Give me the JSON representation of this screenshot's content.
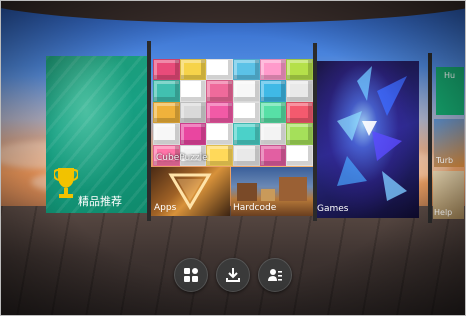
{
  "tiles": {
    "recommended_label": "精品推荐",
    "cubepuzzle_label": "CubePuzzle",
    "apps_label": "Apps",
    "hardcode_label": "Hardcode",
    "games_label": "Games",
    "right_a_label": "Hu",
    "right_b_label": "Turb",
    "right_c_label": "Help"
  },
  "dock": {
    "icons": [
      "apps-grid-icon",
      "download-icon",
      "profile-list-icon"
    ]
  },
  "colors": {
    "accent_green": "#17a083",
    "trophy_gold": "#f2c200"
  }
}
